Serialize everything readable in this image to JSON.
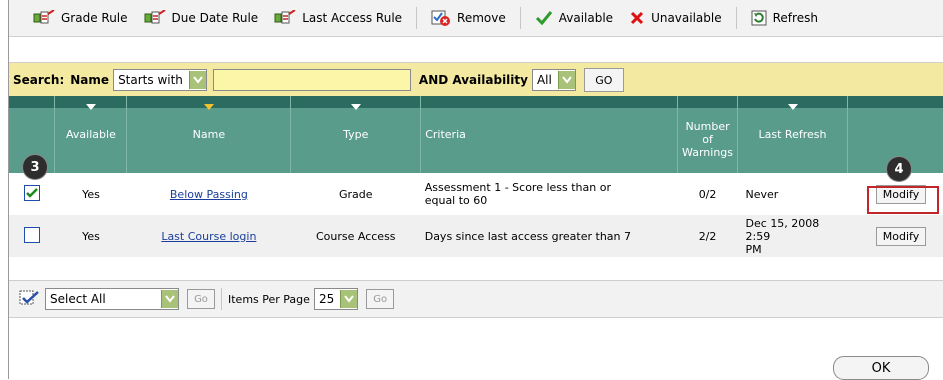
{
  "toolbar": {
    "grade_rule": "Grade Rule",
    "due_date_rule": "Due Date Rule",
    "last_access_rule": "Last Access Rule",
    "remove": "Remove",
    "available": "Available",
    "unavailable": "Unavailable",
    "refresh": "Refresh"
  },
  "search": {
    "label": "Search:",
    "field_label": "Name",
    "operator": "Starts with",
    "value": "",
    "availability_label": "AND Availability",
    "availability_value": "All",
    "go": "GO"
  },
  "table": {
    "headers": {
      "available": "Available",
      "name": "Name",
      "type": "Type",
      "criteria": "Criteria",
      "warnings_1": "Number",
      "warnings_2": "of",
      "warnings_3": "Warnings",
      "last_refresh": "Last Refresh"
    },
    "rows": [
      {
        "available": "Yes",
        "name": "Below Passing",
        "type": "Grade",
        "criteria_1": "Assessment 1 - Score less than or",
        "criteria_2": "equal to 60",
        "warnings": "0/2",
        "last_refresh_1": "Never",
        "last_refresh_2": "",
        "action": "Modify",
        "checked": true
      },
      {
        "available": "Yes",
        "name": "Last Course login",
        "type": "Course Access",
        "criteria_1": "Days since last access greater than 7",
        "criteria_2": "",
        "warnings": "2/2",
        "last_refresh_1": "Dec 15, 2008 2:59",
        "last_refresh_2": "PM",
        "action": "Modify",
        "checked": false
      }
    ]
  },
  "callouts": {
    "c3": "3",
    "c4": "4"
  },
  "bottom": {
    "select_all": "Select All",
    "go": "Go",
    "items_per_page_label": "Items Per Page",
    "items_per_page": "25",
    "go2": "Go"
  },
  "ok": "OK",
  "colors": {
    "header": "#5a9c8c",
    "header_top": "#2c6b5f",
    "search_bg": "#f3e9a0",
    "highlight": "#c0262c",
    "link": "#1a3e9a"
  },
  "icons": [
    "rule-icon",
    "remove-icon",
    "checkmark-icon",
    "x-icon",
    "refresh-icon",
    "chevron-down-icon",
    "select-all-icon"
  ]
}
